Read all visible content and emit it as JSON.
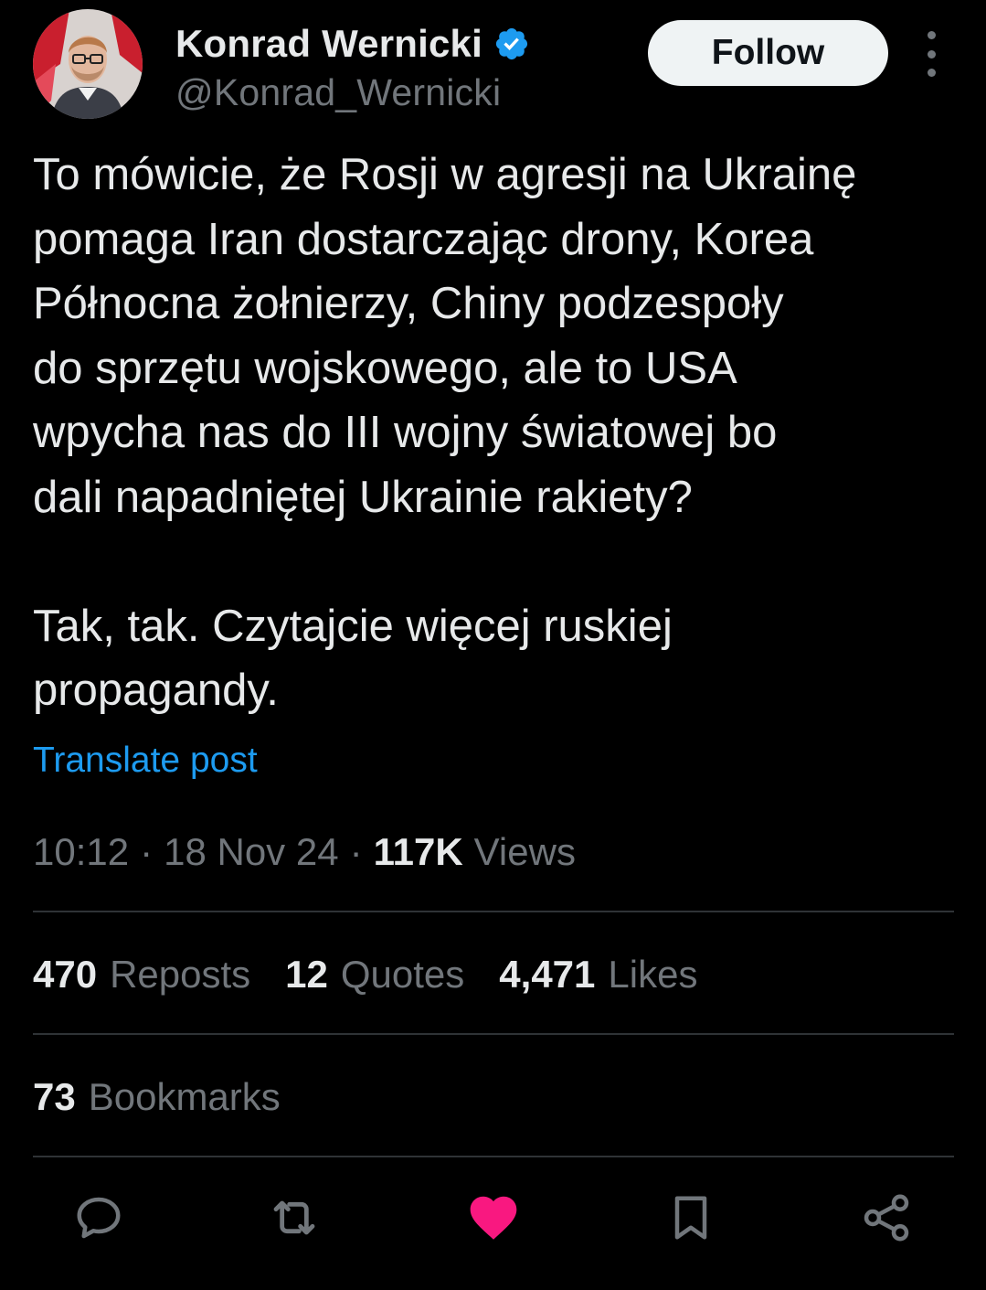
{
  "author": {
    "display_name": "Konrad Wernicki",
    "handle": "@Konrad_Wernicki",
    "verified": true,
    "avatar_icon": "profile-photo"
  },
  "header": {
    "follow_label": "Follow",
    "more_icon": "more-vertical-icon"
  },
  "post": {
    "text": "To mówicie, że Rosji w agresji na Ukrainę\npomaga Iran dostarczając drony, Korea\nPółnocna żołnierzy, Chiny podzespoły\ndo sprzętu wojskowego, ale to USA\nwpycha nas do III wojny światowej bo\ndali napadniętej Ukrainie rakiety?\n\nTak, tak. Czytajcie więcej ruskiej\npropagandy.",
    "translate_label": "Translate post",
    "time": "10:12",
    "date": "18 Nov 24",
    "separator": "·",
    "views_count": "117K",
    "views_label": "Views"
  },
  "stats": {
    "reposts_count": "470",
    "reposts_label": "Reposts",
    "quotes_count": "12",
    "quotes_label": "Quotes",
    "likes_count": "4,471",
    "likes_label": "Likes",
    "bookmarks_count": "73",
    "bookmarks_label": "Bookmarks"
  },
  "actions": [
    {
      "icon": "reply-icon"
    },
    {
      "icon": "repost-icon"
    },
    {
      "icon": "like-icon",
      "active": true
    },
    {
      "icon": "bookmark-icon"
    },
    {
      "icon": "share-icon"
    }
  ],
  "colors": {
    "background": "#000000",
    "text": "#e7e9ea",
    "secondary": "#71767b",
    "link": "#1d9bf0",
    "verified": "#1d9bf0",
    "like_active": "#f91880",
    "divider": "#2f3336"
  }
}
